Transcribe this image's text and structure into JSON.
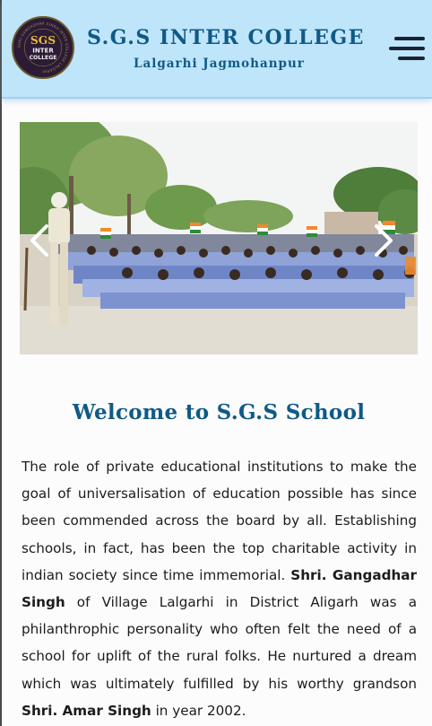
{
  "header": {
    "logo": {
      "line1": "SGS",
      "line2": "INTER",
      "line3": "COLLEGE",
      "ring_text": "SHRI GANGADHAR SINGH INTER COLLEGE LALGARHI"
    },
    "title": "S.G.S INTER COLLEGE",
    "subtitle": "Lalgarhi Jagmohanpur",
    "menu_icon": "hamburger-menu-icon"
  },
  "slider": {
    "image_subject": "students seated outdoors holding flags",
    "prev_icon": "chevron-left-icon",
    "next_icon": "chevron-right-icon"
  },
  "welcome": {
    "heading": "Welcome to S.G.S School",
    "p1": "The role of private educational institutions to make the goal of universalisation of education possible has since been commended across the board by all. Establishing schools, in fact, has been the top charitable activity in indian society since time immemorial. ",
    "name1": "Shri. Gangadhar Singh",
    "p2": " of Village Lalgarhi in District Aligarh was a philanthrophic personality who often felt the need of a school for uplift of the rural folks. He nurtured a dream which was ultimately fulfilled by his worthy grandson ",
    "name2": "Shri. Amar Singh",
    "p3": " in year 2002."
  },
  "colors": {
    "header_bg": "#bfe5fb",
    "brand_blue": "#0f5a86",
    "logo_gold": "#e8b93a",
    "logo_bg": "#2b1b35"
  }
}
